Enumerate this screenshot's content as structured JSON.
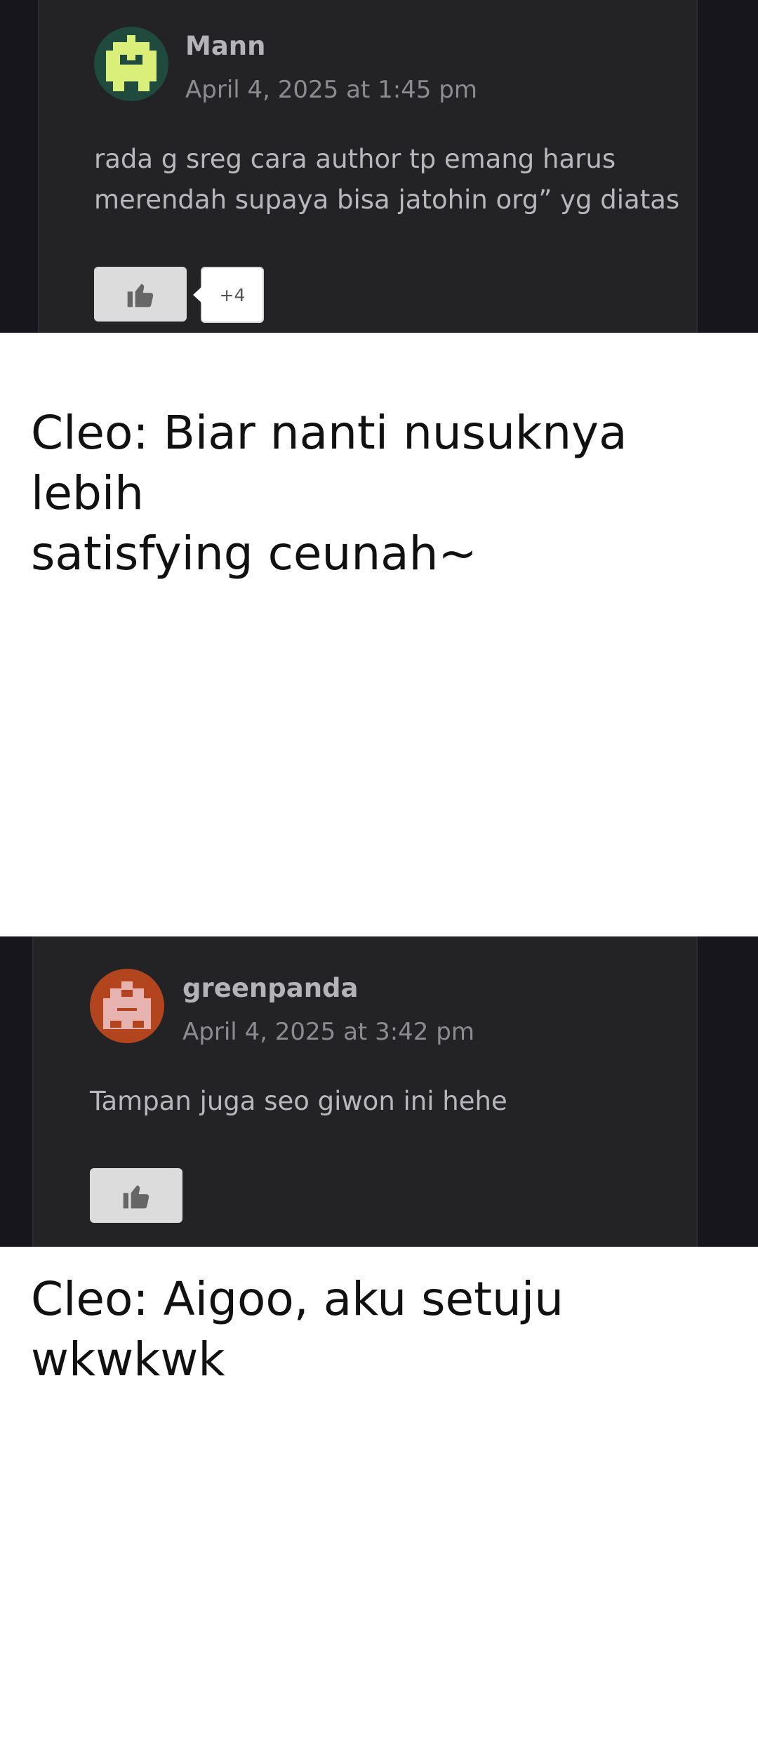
{
  "comments": [
    {
      "author": "Mann",
      "date": "April 4, 2025 at 1:45 pm",
      "lines": [
        "rada g sreg cara author tp emang harus",
        "merendah supaya bisa jatohin org” yg diatas"
      ],
      "likes": "+4",
      "avatar_color": "#d9ef7a",
      "avatar_bg": "#1f4a3d"
    },
    {
      "author": "greenpanda",
      "date": "April 4, 2025 at 3:42 pm",
      "lines": [
        "Tampan juga seo giwon ini hehe"
      ],
      "avatar_color": "#e6b3b0",
      "avatar_bg": "#b2451d"
    }
  ],
  "captions": [
    {
      "lines": [
        "Cleo: Biar nanti nusuknya lebih",
        "satisfying ceunah~"
      ]
    },
    {
      "lines": [
        "Cleo: Aigoo, aku setuju",
        "wkwkwk"
      ]
    }
  ],
  "icons": {
    "like": "thumbs-up-icon"
  }
}
